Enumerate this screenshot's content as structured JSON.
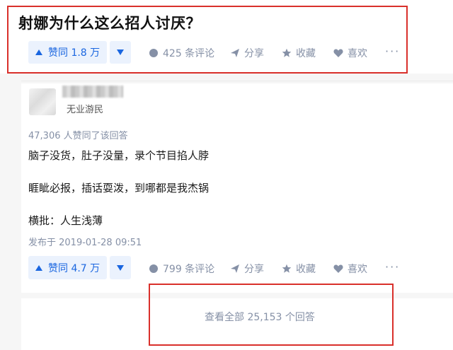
{
  "question": {
    "title": "射娜为什么这么招人讨厌？",
    "upvote_label": "赞同 1.8 万",
    "actions": [
      "425 条评论",
      "分享",
      "收藏",
      "喜欢"
    ]
  },
  "answer": {
    "author_tag": "无业游民",
    "vote_count_text": "47,306 人赞同了该回答",
    "paragraphs": [
      "脑子没货，肚子没量，录个节目掐人脖",
      "睚眦必报，插话耍泼，到哪都是我杰锅",
      "横批：人生浅薄"
    ],
    "publish_time": "发布于 2019-01-28 09:51",
    "upvote_label": "赞同 4.7 万",
    "actions": [
      "799 条评论",
      "分享",
      "收藏",
      "喜欢"
    ]
  },
  "footer": {
    "view_all": "查看全部 25,153 个回答"
  },
  "colors": {
    "accent": "#1a66e0",
    "highlight_box": "#d9302b",
    "muted": "#8590a6"
  }
}
